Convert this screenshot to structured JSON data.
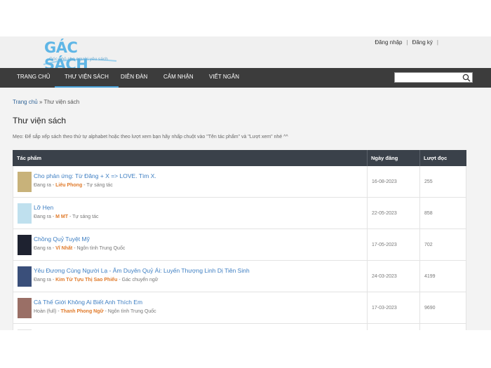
{
  "header": {
    "logo_text": "GÁC SÁCH",
    "logo_tagline": "Góc nhỏ cho người yêu sách",
    "login": "Đăng nhập",
    "register": "Đăng ký",
    "link_sep": "|"
  },
  "nav": {
    "items": [
      {
        "label": "TRANG CHỦ"
      },
      {
        "label": "THƯ VIỆN SÁCH"
      },
      {
        "label": "DIỄN ĐÀN"
      },
      {
        "label": "CẢM NHẬN"
      },
      {
        "label": "VIẾT NGẮN"
      }
    ],
    "search_value": ""
  },
  "breadcrumb": {
    "home": "Trang chủ",
    "sep": " » ",
    "current": "Thư viện sách"
  },
  "page_title": "Thư viện sách",
  "tip": "Mẹo: Để sắp xếp sách theo thứ tự alphabet hoặc theo lượt xem bạn hãy nhấp chuột vào \"Tên tác phẩm\" và \"Lượt xem\" nhé ^^",
  "table": {
    "headers": {
      "work": "Tác phẩm",
      "date": "Ngày đăng",
      "views": "Lượt đọc"
    },
    "rows": [
      {
        "title": "Cho phản ứng: Từ Đăng + X => LOVE. Tìm X.",
        "status": "Đang ra - ",
        "author": "Liêu Phong",
        "category": " - Tự sáng tác",
        "date": "16-08-2023",
        "views": "255",
        "cover_color": "#c8b27a"
      },
      {
        "title": "Lỡ Hẹn",
        "status": "Đang ra - ",
        "author": "M MT",
        "category": " - Tự sáng tác",
        "date": "22-05-2023",
        "views": "858",
        "cover_color": "#bfe0ee"
      },
      {
        "title": "Chồng Quỷ Tuyệt Mỹ",
        "status": "Đang ra - ",
        "author": "Vĩ Nhất",
        "category": " - Ngôn tình Trung Quốc",
        "date": "17-05-2023",
        "views": "702",
        "cover_color": "#1e2230"
      },
      {
        "title": "Yêu Đương Cùng Người Lạ - Âm Duyên Quỷ Ái: Luyến Thượng Linh Dị Tiên Sinh",
        "status": "Đang ra - ",
        "author": "Kim Tử Tựu Thị Sao Phiếu",
        "category": " - Gác chuyển ngữ",
        "date": "24-03-2023",
        "views": "4199",
        "cover_color": "#3a4f7a"
      },
      {
        "title": "Cả Thế Giới Không Ai Biết Anh Thích Em",
        "status": "Hoàn (full) - ",
        "author": "Thanh Phong Ngữ",
        "category": " - Ngôn tình Trung Quốc",
        "date": "17-03-2023",
        "views": "9690",
        "cover_color": "#9a6f66"
      }
    ]
  }
}
